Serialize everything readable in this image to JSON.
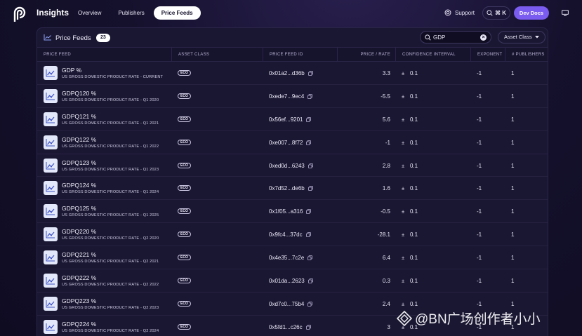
{
  "nav": {
    "brand": "Insights",
    "links": [
      "Overview",
      "Publishers",
      "Price Feeds"
    ],
    "active": "Price Feeds",
    "support": "Support",
    "kbd": "⌘ K",
    "devdocs": "Dev Docs"
  },
  "panel": {
    "title": "Price Feeds",
    "count": "23",
    "search_value": "GDP",
    "asset_select": "Asset Class"
  },
  "table": {
    "headers": [
      "PRICE FEED",
      "ASSET CLASS",
      "PRICE FEED ID",
      "PRICE / RATE",
      "CONFIDENCE INTERVAL",
      "EXPONENT",
      "# PUBLISHERS"
    ],
    "rows": [
      {
        "name": "GDP %",
        "desc": "US GROSS DOMESTIC PRODUCT RATE - CURRENT",
        "asset": "ECO",
        "id": "0x01a2...d36b",
        "price": "3.3",
        "conf": "0.1",
        "exponent": "-1",
        "publishers": "1"
      },
      {
        "name": "GDPQ120 %",
        "desc": "US GROSS DOMESTIC PRODUCT RATE - Q1 2020",
        "asset": "ECO",
        "id": "0xede7...9ec4",
        "price": "-5.5",
        "conf": "0.1",
        "exponent": "-1",
        "publishers": "1"
      },
      {
        "name": "GDPQ121 %",
        "desc": "US GROSS DOMESTIC PRODUCT RATE - Q1 2021",
        "asset": "ECO",
        "id": "0x56ef...9201",
        "price": "5.6",
        "conf": "0.1",
        "exponent": "-1",
        "publishers": "1"
      },
      {
        "name": "GDPQ122 %",
        "desc": "US GROSS DOMESTIC PRODUCT RATE - Q1 2022",
        "asset": "ECO",
        "id": "0xe007...8f72",
        "price": "-1",
        "conf": "0.1",
        "exponent": "-1",
        "publishers": "1"
      },
      {
        "name": "GDPQ123 %",
        "desc": "US GROSS DOMESTIC PRODUCT RATE - Q1 2023",
        "asset": "ECO",
        "id": "0xed0d...6243",
        "price": "2.8",
        "conf": "0.1",
        "exponent": "-1",
        "publishers": "1"
      },
      {
        "name": "GDPQ124 %",
        "desc": "US GROSS DOMESTIC PRODUCT RATE - Q1 2024",
        "asset": "ECO",
        "id": "0x7d52...de6b",
        "price": "1.6",
        "conf": "0.1",
        "exponent": "-1",
        "publishers": "1"
      },
      {
        "name": "GDPQ125 %",
        "desc": "US GROSS DOMESTIC PRODUCT RATE - Q1 2025",
        "asset": "ECO",
        "id": "0x1f05...a316",
        "price": "-0.5",
        "conf": "0.1",
        "exponent": "-1",
        "publishers": "1"
      },
      {
        "name": "GDPQ220 %",
        "desc": "US GROSS DOMESTIC PRODUCT RATE - Q2 2020",
        "asset": "ECO",
        "id": "0x9fc4...37dc",
        "price": "-28.1",
        "conf": "0.1",
        "exponent": "-1",
        "publishers": "1"
      },
      {
        "name": "GDPQ221 %",
        "desc": "US GROSS DOMESTIC PRODUCT RATE - Q2 2021",
        "asset": "ECO",
        "id": "0x4e35...7c2e",
        "price": "6.4",
        "conf": "0.1",
        "exponent": "-1",
        "publishers": "1"
      },
      {
        "name": "GDPQ222 %",
        "desc": "US GROSS DOMESTIC PRODUCT RATE - Q2 2022",
        "asset": "ECO",
        "id": "0x01da...2623",
        "price": "0.3",
        "conf": "0.1",
        "exponent": "-1",
        "publishers": "1"
      },
      {
        "name": "GDPQ223 %",
        "desc": "US GROSS DOMESTIC PRODUCT RATE - Q2 2023",
        "asset": "ECO",
        "id": "0xd7c0...75b4",
        "price": "2.4",
        "conf": "0.1",
        "exponent": "-1",
        "publishers": "1"
      },
      {
        "name": "GDPQ224 %",
        "desc": "US GROSS DOMESTIC PRODUCT RATE - Q2 2024",
        "asset": "ECO",
        "id": "0x5fd1...c26c",
        "price": "3",
        "conf": "0.1",
        "exponent": "-1",
        "publishers": "1"
      }
    ]
  },
  "watermark": "@BN广场创作者小小",
  "colors": {
    "accent": "#7b5cf0",
    "background": "#100d24",
    "panel": "#1a1733",
    "feed_icon_bg": "#e3e8fb"
  }
}
